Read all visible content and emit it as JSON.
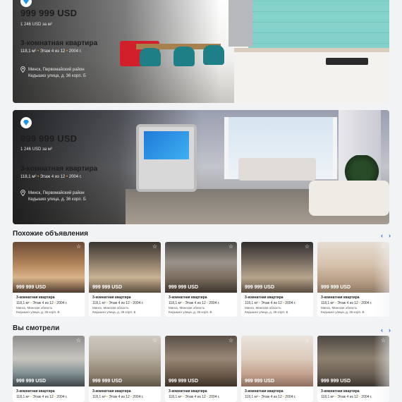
{
  "featured": [
    {
      "price": "999 999 USD",
      "price_per_m2": "1 246 USD за м²",
      "title": "3-комнатная квартира",
      "area": "118,1 м²",
      "floor": "Этаж 4 из 12",
      "year": "2004 г.",
      "address_line1": "Минск, Первомайский район",
      "address_line2": "Кедышко улица, д. 36 корп. Б"
    },
    {
      "price": "999 999 USD",
      "price_per_m2": "1 246 USD за м²",
      "title": "3-комнатная квартира",
      "area": "118,1 м²",
      "floor": "Этаж 4 из 12",
      "year": "2004 г.",
      "address_line1": "Минск, Первомайский район",
      "address_line2": "Кедышко улица, д. 36 корп. Б"
    }
  ],
  "similar": {
    "title": "Похожие объявления",
    "cards": [
      {
        "price": "999 999 USD",
        "title": "3-комнатная квартира",
        "area": "118,1 м²",
        "floor": "Этаж 4 из 12",
        "year": "2004 г.",
        "address_line1": "Минск, Минская область",
        "address_line2": "Кедышко улица, д. 36 корп. Б"
      },
      {
        "price": "999 999 USD",
        "title": "3-комнатная квартира",
        "area": "118,1 м²",
        "floor": "Этаж 4 из 12",
        "year": "2004 г.",
        "address_line1": "Минск, Минская область",
        "address_line2": "Кедышко улица, д. 36 корп. Б"
      },
      {
        "price": "999 999 USD",
        "title": "3-комнатная квартира",
        "area": "118,1 м²",
        "floor": "Этаж 4 из 12",
        "year": "2004 г.",
        "address_line1": "Минск, Минская область",
        "address_line2": "Кедышко улица, д. 36 корп. Б"
      },
      {
        "price": "999 999 USD",
        "title": "3-комнатная квартира",
        "area": "118,1 м²",
        "floor": "Этаж 4 из 12",
        "year": "2004 г.",
        "address_line1": "Минск, Минская область",
        "address_line2": "Кедышко улица, д. 36 корп. Б"
      },
      {
        "price": "999 999 USD",
        "title": "3-комнатная квартира",
        "area": "118,1 м²",
        "floor": "Этаж 4 из 12",
        "year": "2004 г.",
        "address_line1": "Минск, Минская область",
        "address_line2": "Кедышко улица, д. 36 корп. Б"
      }
    ]
  },
  "viewed": {
    "title": "Вы смотрели",
    "cards": [
      {
        "price": "999 999 USD",
        "title": "3-комнатная квартира",
        "area": "118,1 м²",
        "floor": "Этаж 4 из 12",
        "year": "2004 г."
      },
      {
        "price": "999 999 USD",
        "title": "3-комнатная квартира",
        "area": "118,1 м²",
        "floor": "Этаж 4 из 12",
        "year": "2004 г."
      },
      {
        "price": "999 999 USD",
        "title": "3-комнатная квартира",
        "area": "118,1 м²",
        "floor": "Этаж 4 из 12",
        "year": "2004 г."
      },
      {
        "price": "999 999 USD",
        "title": "3-комнатная квартира",
        "area": "118,1 м²",
        "floor": "Этаж 4 из 12",
        "year": "2004 г."
      },
      {
        "price": "999 999 USD",
        "title": "3-комнатная квартира",
        "area": "118,1 м²",
        "floor": "Этаж 4 из 12",
        "year": "2004 г."
      }
    ]
  },
  "icons": {
    "badge": "diamond-icon",
    "location": "location-pin-icon",
    "favorite": "star-icon",
    "prev": "chevron-left-icon",
    "next": "chevron-right-icon"
  },
  "colors": {
    "accent": "#1f6fd9",
    "badge": "#1e96e8",
    "meta_dot": "#f5a623",
    "background": "#f2f3f5"
  },
  "glyphs": {
    "prev": "‹",
    "next": "›",
    "star": "☆",
    "dot": "•"
  }
}
